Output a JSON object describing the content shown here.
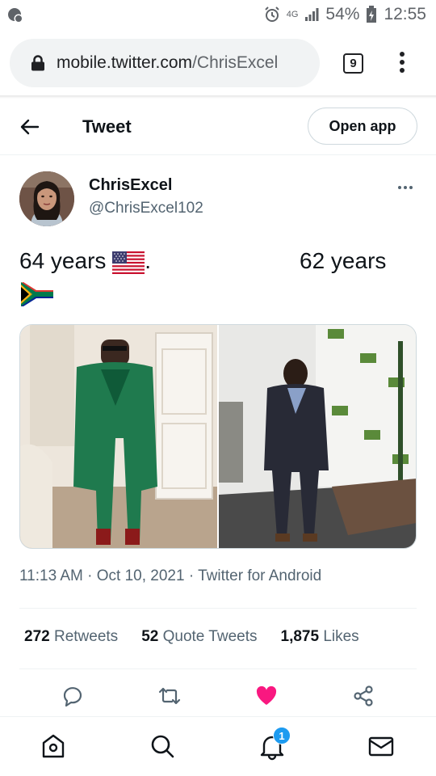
{
  "status_bar": {
    "network": "4G",
    "battery": "54%",
    "time": "12:55"
  },
  "browser": {
    "url_host": "mobile.twitter.com",
    "url_path": "/ChrisExcel",
    "tab_count": "9"
  },
  "header": {
    "title": "Tweet",
    "open_app_label": "Open app"
  },
  "tweet": {
    "display_name": "ChrisExcel",
    "handle": "@ChrisExcel102",
    "text_left": "64 years",
    "text_left_suffix": ".",
    "text_right": "62 years",
    "timestamp": "11:13 AM · Oct 10, 2021 · Twitter for Android",
    "stats": [
      {
        "count": "272",
        "label": "Retweets"
      },
      {
        "count": "52",
        "label": "Quote Tweets"
      },
      {
        "count": "1,875",
        "label": "Likes"
      }
    ]
  },
  "bottom_nav": {
    "notification_count": "1"
  },
  "colors": {
    "accent": "#1d9bf0",
    "like": "#f91880",
    "text_secondary": "#536471"
  },
  "icons": [
    "alarm-icon",
    "signal-icon",
    "battery-icon",
    "lock-icon",
    "back-arrow-icon",
    "more-icon",
    "usa-flag-icon",
    "south-africa-flag-icon",
    "reply-icon",
    "retweet-icon",
    "heart-icon",
    "share-icon",
    "home-icon",
    "search-icon",
    "bell-icon",
    "mail-icon"
  ]
}
